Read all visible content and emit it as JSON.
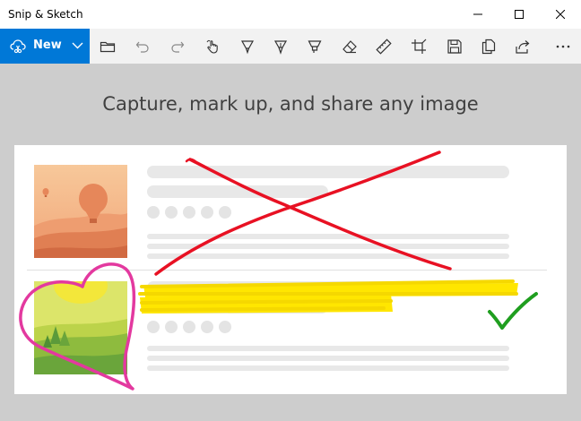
{
  "window": {
    "title": "Snip & Sketch"
  },
  "toolbar": {
    "new_label": "New"
  },
  "icons": {
    "new": "snip-icon",
    "chevron": "chevron-down-icon",
    "open": "folder-icon",
    "undo": "undo-icon",
    "redo": "redo-icon",
    "touch": "touch-writing-icon",
    "ballpoint": "ballpoint-pen-icon",
    "pencil": "pencil-icon",
    "highlighter": "highlighter-icon",
    "eraser": "eraser-icon",
    "ruler": "ruler-icon",
    "crop": "crop-icon",
    "save": "save-icon",
    "copy": "copy-icon",
    "share": "share-icon",
    "more": "more-icon"
  },
  "main": {
    "headline": "Capture, mark up, and share any image"
  },
  "colors": {
    "accent": "#0078d7",
    "red_ink": "#e81123",
    "yellow_highlight": "#ffe600",
    "pink_ink": "#e3399f",
    "green_ink": "#1f9e1f"
  }
}
